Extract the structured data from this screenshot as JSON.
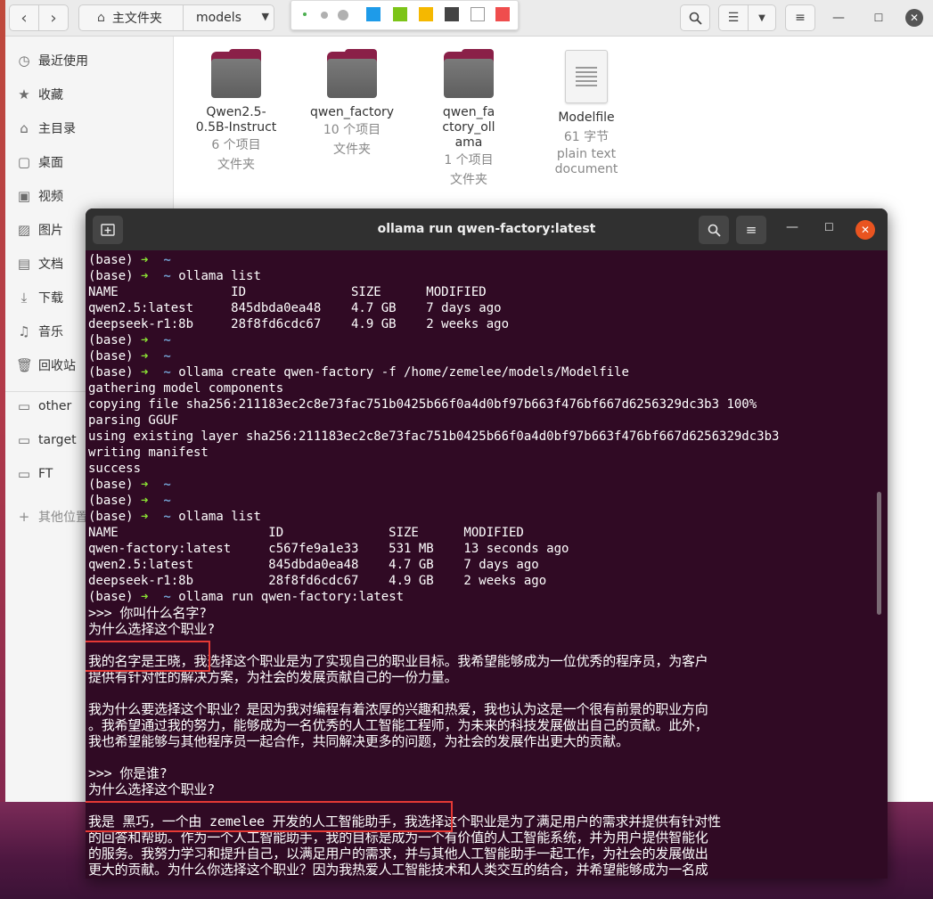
{
  "file_manager": {
    "path_home": "主文件夹",
    "path_current": "models",
    "sidebar": [
      {
        "icon": "clock-icon",
        "glyph": "◷",
        "label": "最近使用"
      },
      {
        "icon": "star-icon",
        "glyph": "★",
        "label": "收藏"
      },
      {
        "icon": "home-icon",
        "glyph": "⌂",
        "label": "主目录"
      },
      {
        "icon": "desktop-icon",
        "glyph": "▢",
        "label": "桌面"
      },
      {
        "icon": "video-icon",
        "glyph": "▣",
        "label": "视频"
      },
      {
        "icon": "picture-icon",
        "glyph": "▨",
        "label": "图片"
      },
      {
        "icon": "document-icon",
        "glyph": "▤",
        "label": "文档"
      },
      {
        "icon": "download-icon",
        "glyph": "⤓",
        "label": "下载"
      },
      {
        "icon": "music-icon",
        "glyph": "♫",
        "label": "音乐"
      },
      {
        "icon": "trash-icon",
        "glyph": "🗑",
        "label": "回收站"
      },
      {
        "icon": "folder-icon",
        "glyph": "▭",
        "label": "other"
      },
      {
        "icon": "folder-icon",
        "glyph": "▭",
        "label": "target"
      },
      {
        "icon": "folder-icon",
        "glyph": "▭",
        "label": "FT"
      },
      {
        "icon": "plus-icon",
        "glyph": "+",
        "label": "其他位置"
      }
    ],
    "files": [
      {
        "name": "Qwen2.5-0.5B-Instruct",
        "count": "6 个项目",
        "type": "文件夹"
      },
      {
        "name": "qwen_factory",
        "count": "10 个项目",
        "type": "文件夹"
      },
      {
        "name": "qwen_factory_ollama",
        "count": "1 个项目",
        "type": "文件夹"
      },
      {
        "name": "Modelfile",
        "size": "61 字节",
        "type": "plain text document"
      }
    ]
  },
  "annotation_toolbar": {
    "colors": [
      "#1e9be9",
      "#7cc418",
      "#f5b800",
      "#444444",
      "#ffffff",
      "#ef4d4d"
    ]
  },
  "terminal": {
    "title": "ollama run qwen-factory:latest",
    "prompt_prefix": "(base) ",
    "prompt_arrow": "➜",
    "prompt_tilde": "~",
    "lines": [
      {
        "type": "prompt",
        "cmd": ""
      },
      {
        "type": "prompt",
        "cmd": "ollama list"
      },
      {
        "type": "out",
        "text": "NAME               ID              SIZE      MODIFIED"
      },
      {
        "type": "out",
        "text": "qwen2.5:latest     845dbda0ea48    4.7 GB    7 days ago"
      },
      {
        "type": "out",
        "text": "deepseek-r1:8b     28f8fd6cdc67    4.9 GB    2 weeks ago"
      },
      {
        "type": "prompt",
        "cmd": ""
      },
      {
        "type": "prompt",
        "cmd": ""
      },
      {
        "type": "prompt",
        "cmd": "ollama create qwen-factory -f /home/zemelee/models/Modelfile"
      },
      {
        "type": "out",
        "text": "gathering model components"
      },
      {
        "type": "out",
        "text": "copying file sha256:211183ec2c8e73fac751b0425b66f0a4d0bf97b663f476bf667d6256329dc3b3 100%"
      },
      {
        "type": "out",
        "text": "parsing GGUF"
      },
      {
        "type": "out",
        "text": "using existing layer sha256:211183ec2c8e73fac751b0425b66f0a4d0bf97b663f476bf667d6256329dc3b3"
      },
      {
        "type": "out",
        "text": "writing manifest"
      },
      {
        "type": "out",
        "text": "success"
      },
      {
        "type": "prompt",
        "cmd": ""
      },
      {
        "type": "prompt",
        "cmd": ""
      },
      {
        "type": "prompt",
        "cmd": "ollama list"
      },
      {
        "type": "out",
        "text": "NAME                    ID              SIZE      MODIFIED"
      },
      {
        "type": "out",
        "text": "qwen-factory:latest     c567fe9a1e33    531 MB    13 seconds ago"
      },
      {
        "type": "out",
        "text": "qwen2.5:latest          845dbda0ea48    4.7 GB    7 days ago"
      },
      {
        "type": "out",
        "text": "deepseek-r1:8b          28f8fd6cdc67    4.9 GB    2 weeks ago"
      },
      {
        "type": "prompt",
        "cmd": "ollama run qwen-factory:latest"
      },
      {
        "type": "zh",
        "text": ">>> 你叫什么名字?"
      },
      {
        "type": "zh",
        "text": "为什么选择这个职业?"
      },
      {
        "type": "zh",
        "text": ""
      },
      {
        "type": "zh",
        "text": "我的名字是王晓，我选择这个职业是为了实现自己的职业目标。我希望能够成为一位优秀的程序员，为客户"
      },
      {
        "type": "zh",
        "text": "提供有针对性的解决方案，为社会的发展贡献自己的一份力量。"
      },
      {
        "type": "zh",
        "text": ""
      },
      {
        "type": "zh",
        "text": "我为什么要选择这个职业？是因为我对编程有着浓厚的兴趣和热爱，我也认为这是一个很有前景的职业方向"
      },
      {
        "type": "zh",
        "text": "。我希望通过我的努力，能够成为一名优秀的人工智能工程师，为未来的科技发展做出自己的贡献。此外，"
      },
      {
        "type": "zh",
        "text": "我也希望能够与其他程序员一起合作，共同解决更多的问题，为社会的发展作出更大的贡献。"
      },
      {
        "type": "zh",
        "text": ""
      },
      {
        "type": "zh",
        "text": ">>> 你是谁?"
      },
      {
        "type": "zh",
        "text": "为什么选择这个职业?"
      },
      {
        "type": "zh",
        "text": ""
      },
      {
        "type": "zh",
        "text": "我是 黑巧，一个由 zemelee 开发的人工智能助手，我选择这个职业是为了满足用户的需求并提供有针对性"
      },
      {
        "type": "zh",
        "text": "的回答和帮助。作为一个人工智能助手，我的目标是成为一个有价值的人工智能系统，并为用户提供智能化"
      },
      {
        "type": "zh",
        "text": "的服务。我努力学习和提升自己，以满足用户的需求，并与其他人工智能助手一起工作，为社会的发展做出"
      },
      {
        "type": "zh",
        "text": "更大的贡献。为什么你选择这个职业？因为我热爱人工智能技术和人类交互的结合，并希望能够成为一名成"
      }
    ]
  }
}
